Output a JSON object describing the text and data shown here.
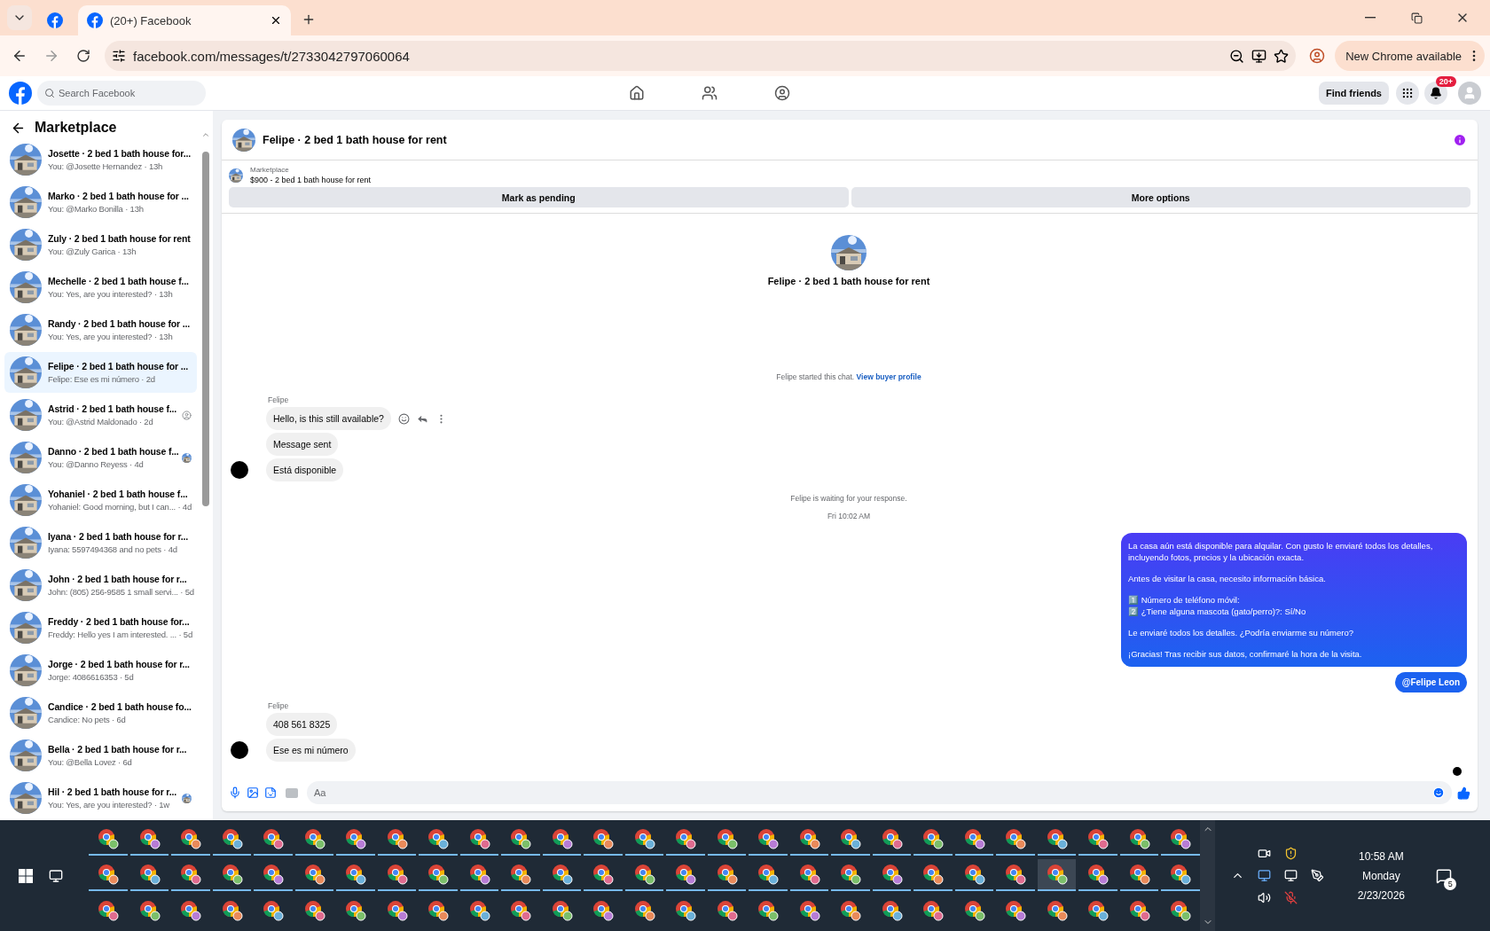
{
  "browser": {
    "tab_title": "(20+) Facebook",
    "url": "facebook.com/messages/t/2733042797060064",
    "update_button": "New Chrome available"
  },
  "facebook_header": {
    "search_placeholder": "Search Facebook",
    "find_friends": "Find friends",
    "notification_badge": "20+"
  },
  "sidebar": {
    "title": "Marketplace",
    "items": [
      {
        "title": "Josette · 2 bed 1 bath house for...",
        "preview": "You: @Josette Hernandez · 13h",
        "selected": false
      },
      {
        "title": "Marko · 2 bed 1 bath house for ...",
        "preview": "You: @Marko Bonilla · 13h",
        "selected": false
      },
      {
        "title": "Zuly · 2 bed 1 bath house for rent",
        "preview": "You: @Zuly Garica · 13h",
        "selected": false
      },
      {
        "title": "Mechelle · 2 bed 1 bath house f...",
        "preview": "You: Yes, are you interested? · 13h",
        "selected": false
      },
      {
        "title": "Randy · 2 bed 1 bath house for ...",
        "preview": "You: Yes, are you interested? · 13h",
        "selected": false
      },
      {
        "title": "Felipe · 2 bed 1 bath house for ...",
        "preview": "Felipe: Ese es mi número · 2d",
        "selected": true
      },
      {
        "title": "Astrid · 2 bed 1 bath house f...",
        "preview": "You: @Astrid Maldonado · 2d",
        "selected": false,
        "seen_avatar": {
          "kind": "silhouette"
        }
      },
      {
        "title": "Danno · 2 bed 1 bath house f...",
        "preview": "You: @Danno Reyess · 4d",
        "selected": false
      },
      {
        "title": "Yohaniel · 2 bed 1 bath house f...",
        "preview": "Yohaniel: Good morning, but I can... · 4d",
        "selected": false
      },
      {
        "title": "Iyana · 2 bed 1 bath house for r...",
        "preview": "Iyana: 5597494368 and no pets · 4d",
        "selected": false
      },
      {
        "title": "John · 2 bed 1 bath house for r...",
        "preview": "John: (805) 256-9585 1 small servi... · 5d",
        "selected": false
      },
      {
        "title": "Freddy · 2 bed 1 bath house for...",
        "preview": "Freddy: Hello yes I am interested. ... · 5d",
        "selected": false
      },
      {
        "title": "Jorge · 2 bed 1 bath house for r...",
        "preview": "Jorge: 4086616353 · 5d",
        "selected": false
      },
      {
        "title": "Candice · 2 bed 1 bath house fo...",
        "preview": "Candice: No pets · 6d",
        "selected": false
      },
      {
        "title": "Bella · 2 bed 1 bath house for r...",
        "preview": "You: @Bella Lovez · 6d",
        "selected": false
      },
      {
        "title": "Hil · 2 bed 1 bath house for r...",
        "preview": "You: Yes, are you interested? · 1w",
        "selected": false
      }
    ]
  },
  "chat": {
    "title": "Felipe · 2 bed 1 bath house for rent",
    "listing": {
      "source": "Marketplace",
      "text": "$900 - 2 bed 1 bath house for rent"
    },
    "actions": [
      "Mark as pending",
      "More options"
    ],
    "intro_title": "Felipe · 2 bed 1 bath house for rent",
    "messages": [
      {
        "kind": "system",
        "text": "Felipe started this chat.",
        "link": "View buyer profile"
      },
      {
        "kind": "incoming",
        "sender": "Felipe",
        "bubbles": [
          {
            "text": "Hello, is this still available?",
            "hovered": true
          },
          {
            "text": "Message sent",
            "hovered": false
          },
          {
            "text": "Está disponible",
            "hovered": false
          }
        ]
      },
      {
        "kind": "status",
        "text": "Felipe is waiting for your response."
      },
      {
        "kind": "timestamp",
        "text": "Fri 10:02 AM"
      },
      {
        "kind": "outgoing",
        "paragraphs": [
          "La casa aún está disponible para alquilar. Con gusto le enviaré todos los detalles, incluyendo fotos, precios y la ubicación exacta.",
          "Antes de visitar la casa, necesito información básica.",
          "1️⃣ Número de teléfono móvil:\n2️⃣ ¿Tiene alguna mascota (gato/perro)?: Sí/No",
          "Le enviaré todos los detalles. ¿Podría enviarme su número?",
          "¡Gracias! Tras recibir sus datos, confirmaré la hora de la visita."
        ]
      },
      {
        "kind": "mention",
        "text": "@Felipe Leon"
      },
      {
        "kind": "incoming",
        "sender": "Felipe",
        "bubbles": [
          {
            "text": "408 561 8325",
            "hovered": false
          },
          {
            "text": "Ese es mi número",
            "hovered": false
          }
        ]
      },
      {
        "kind": "seen"
      }
    ],
    "composer_placeholder": "Aa"
  },
  "taskbar": {
    "rows": [
      [
        {
          "running": true,
          "selected": false
        },
        {
          "running": true,
          "selected": false
        },
        {
          "running": true,
          "selected": false
        },
        {
          "running": true,
          "selected": false
        },
        {
          "running": true,
          "selected": false
        },
        {
          "running": true,
          "selected": false
        },
        {
          "running": true,
          "selected": false
        },
        {
          "running": true,
          "selected": false
        },
        {
          "running": true,
          "selected": false
        },
        {
          "running": true,
          "selected": false
        },
        {
          "running": true,
          "selected": false
        },
        {
          "running": true,
          "selected": false
        },
        {
          "running": true,
          "selected": false
        },
        {
          "running": true,
          "selected": false
        },
        {
          "running": true,
          "selected": false
        },
        {
          "running": true,
          "selected": false
        },
        {
          "running": true,
          "selected": false
        },
        {
          "running": true,
          "selected": false
        },
        {
          "running": true,
          "selected": false
        },
        {
          "running": true,
          "selected": false
        },
        {
          "running": true,
          "selected": false
        },
        {
          "running": true,
          "selected": false
        },
        {
          "running": true,
          "selected": false
        },
        {
          "running": true,
          "selected": false
        },
        {
          "running": true,
          "selected": false
        },
        {
          "running": true,
          "selected": false
        },
        {
          "running": true,
          "selected": false
        }
      ],
      [
        {
          "running": true,
          "selected": false
        },
        {
          "running": true,
          "selected": false
        },
        {
          "running": true,
          "selected": false
        },
        {
          "running": true,
          "selected": false
        },
        {
          "running": true,
          "selected": false
        },
        {
          "running": true,
          "selected": false
        },
        {
          "running": true,
          "selected": false
        },
        {
          "running": true,
          "selected": false
        },
        {
          "running": true,
          "selected": false
        },
        {
          "running": true,
          "selected": false
        },
        {
          "running": true,
          "selected": false
        },
        {
          "running": true,
          "selected": false
        },
        {
          "running": true,
          "selected": false
        },
        {
          "running": true,
          "selected": false
        },
        {
          "running": true,
          "selected": false
        },
        {
          "running": true,
          "selected": false
        },
        {
          "running": true,
          "selected": false
        },
        {
          "running": true,
          "selected": false
        },
        {
          "running": true,
          "selected": false
        },
        {
          "running": true,
          "selected": false
        },
        {
          "running": true,
          "selected": false
        },
        {
          "running": true,
          "selected": false
        },
        {
          "running": true,
          "selected": false
        },
        {
          "running": true,
          "selected": true
        },
        {
          "running": true,
          "selected": false
        },
        {
          "running": true,
          "selected": false
        },
        {
          "running": true,
          "selected": false
        }
      ],
      [
        {
          "running": false,
          "selected": false
        },
        {
          "running": false,
          "selected": false
        },
        {
          "running": false,
          "selected": false
        },
        {
          "running": false,
          "selected": false
        },
        {
          "running": false,
          "selected": false
        },
        {
          "running": false,
          "selected": false
        },
        {
          "running": false,
          "selected": false
        },
        {
          "running": false,
          "selected": false
        },
        {
          "running": false,
          "selected": false
        },
        {
          "running": false,
          "selected": false
        },
        {
          "running": false,
          "selected": false
        },
        {
          "running": false,
          "selected": false
        },
        {
          "running": false,
          "selected": false
        },
        {
          "running": false,
          "selected": false
        },
        {
          "running": false,
          "selected": false
        },
        {
          "running": false,
          "selected": false
        },
        {
          "running": false,
          "selected": false
        },
        {
          "running": false,
          "selected": false
        },
        {
          "running": false,
          "selected": false
        },
        {
          "running": false,
          "selected": false
        },
        {
          "running": false,
          "selected": false
        },
        {
          "running": false,
          "selected": false
        },
        {
          "running": false,
          "selected": false
        },
        {
          "running": false,
          "selected": false
        },
        {
          "running": false,
          "selected": false
        },
        {
          "running": false,
          "selected": false
        },
        {
          "running": false,
          "selected": false
        }
      ]
    ],
    "time": "10:58 AM",
    "day": "Monday",
    "date": "2/23/2026",
    "notifications": "5"
  }
}
